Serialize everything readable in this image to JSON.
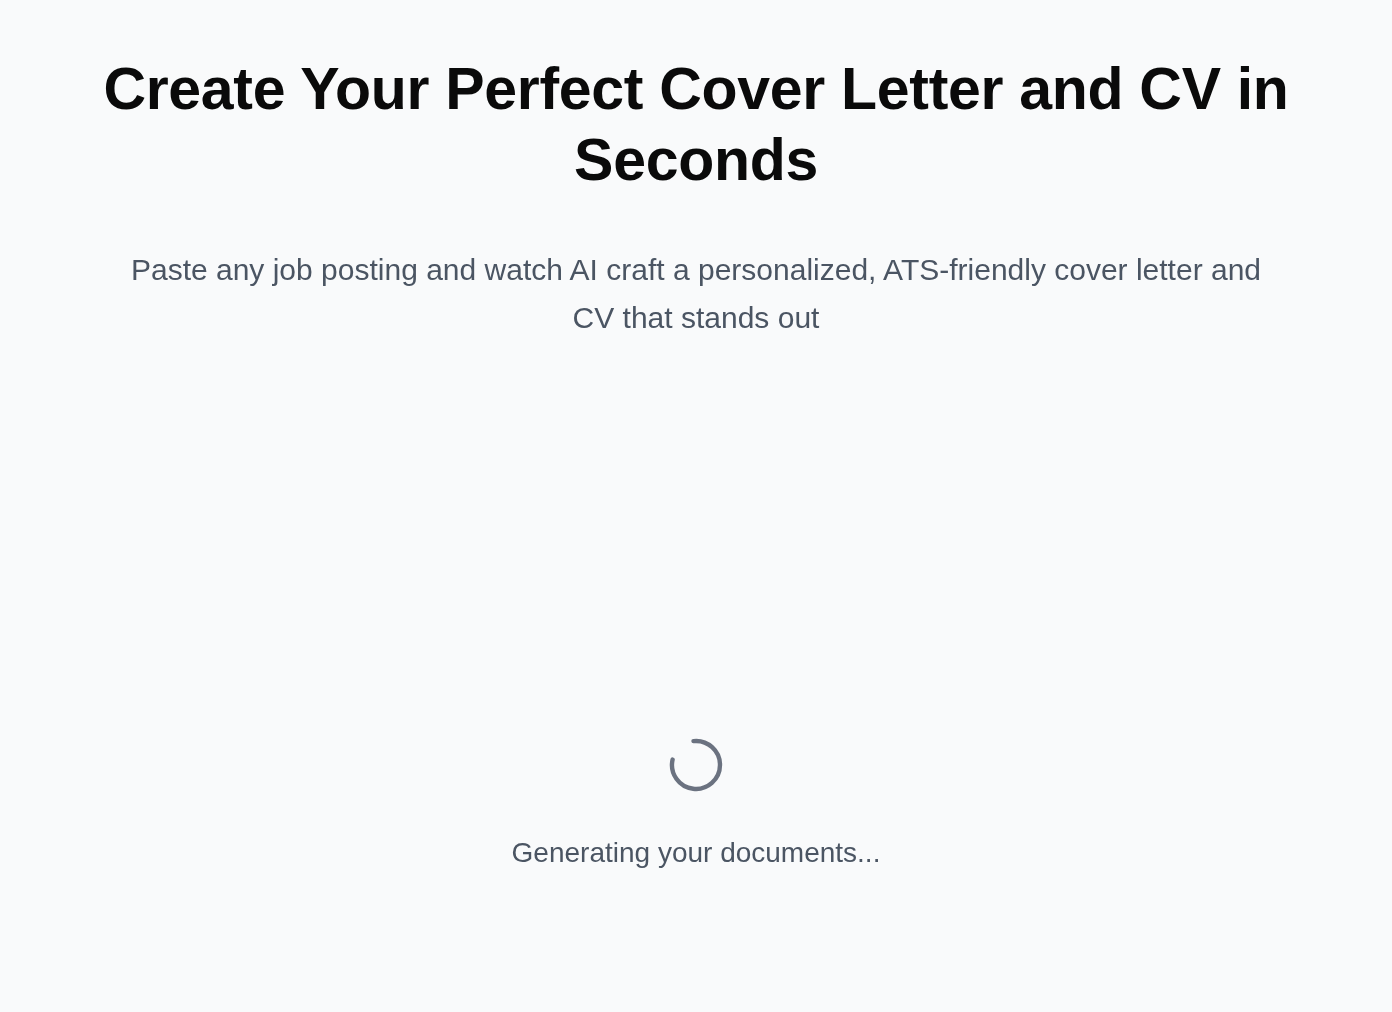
{
  "header": {
    "title": "Create Your Perfect Cover Letter and CV in Seconds",
    "subtitle": "Paste any job posting and watch AI craft a personalized, ATS-friendly cover letter and CV that stands out"
  },
  "loading": {
    "message": "Generating your documents..."
  }
}
